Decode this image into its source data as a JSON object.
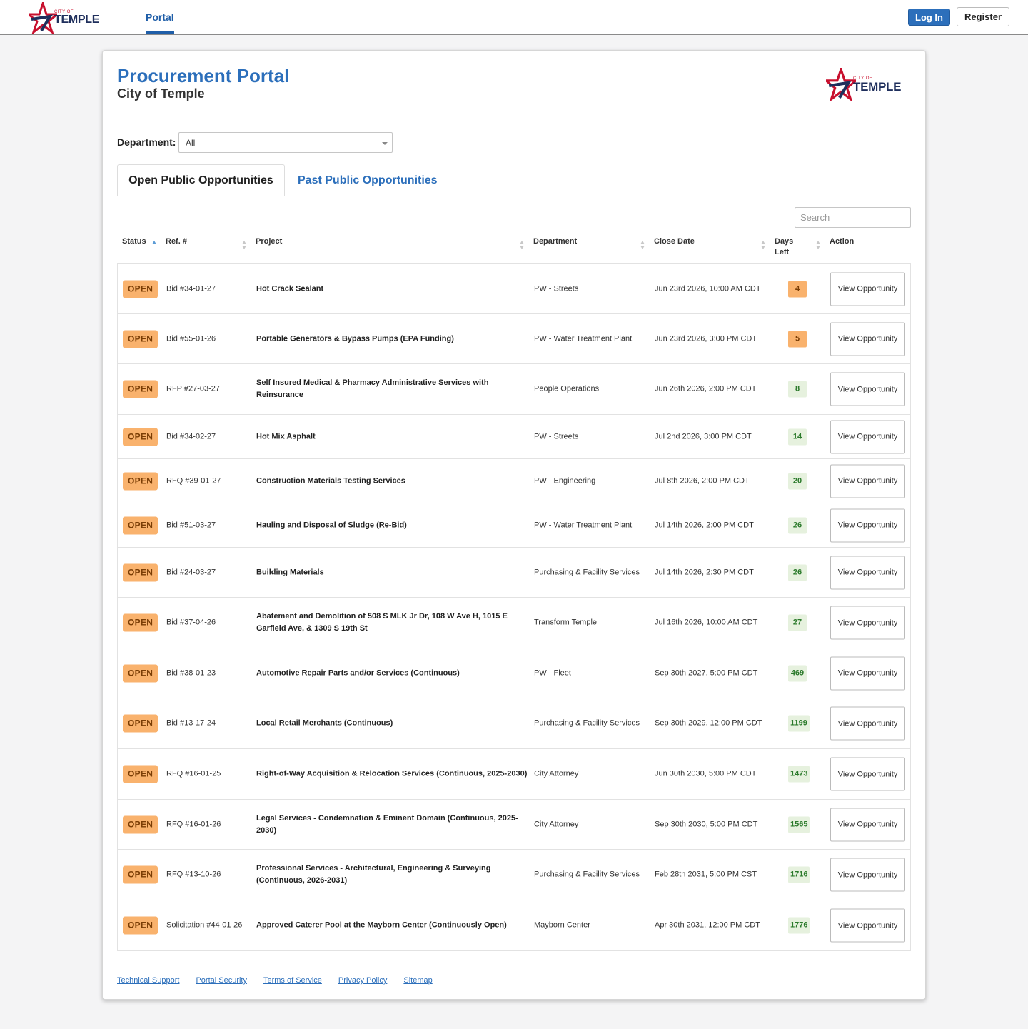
{
  "brand": {
    "city_of": "CITY OF",
    "temple": "TEMPLE"
  },
  "nav": {
    "portal_tab": "Portal",
    "login": "Log In",
    "register": "Register"
  },
  "header": {
    "title": "Procurement Portal",
    "subtitle": "City of Temple"
  },
  "filter": {
    "label": "Department:",
    "selected": "All"
  },
  "tabs": {
    "open": "Open Public Opportunities",
    "past": "Past Public Opportunities"
  },
  "search": {
    "placeholder": "Search"
  },
  "table": {
    "columns": [
      "Status",
      "Ref. #",
      "Project",
      "Department",
      "Close Date",
      "Days Left",
      "Action"
    ],
    "rows": [
      {
        "status": "OPEN",
        "ref": "Bid #34-01-27",
        "project": "Hot Crack Sealant",
        "department": "PW - Streets",
        "close": "Jun 23rd 2026, 10:00 AM CDT",
        "days": "4",
        "action": "View Opportunity"
      },
      {
        "status": "OPEN",
        "ref": "Bid #55-01-26",
        "project": "Portable Generators & Bypass Pumps (EPA Funding)",
        "department": "PW - Water Treatment Plant",
        "close": "Jun 23rd 2026, 3:00 PM CDT",
        "days": "5",
        "action": "View Opportunity"
      },
      {
        "status": "OPEN",
        "ref": "RFP #27-03-27",
        "project": "Self Insured Medical & Pharmacy Administrative Services with Reinsurance",
        "department": "People Operations",
        "close": "Jun 26th 2026, 2:00 PM CDT",
        "days": "8",
        "action": "View Opportunity"
      },
      {
        "status": "OPEN",
        "ref": "Bid #34-02-27",
        "project": "Hot Mix Asphalt",
        "department": "PW - Streets",
        "close": "Jul 2nd 2026, 3:00 PM CDT",
        "days": "14",
        "action": "View Opportunity"
      },
      {
        "status": "OPEN",
        "ref": "RFQ #39-01-27",
        "project": "Construction Materials Testing Services",
        "department": "PW - Engineering",
        "close": "Jul 8th 2026, 2:00 PM CDT",
        "days": "20",
        "action": "View Opportunity"
      },
      {
        "status": "OPEN",
        "ref": "Bid #51-03-27",
        "project": "Hauling and Disposal of Sludge (Re-Bid)",
        "department": "PW - Water Treatment Plant",
        "close": "Jul 14th 2026, 2:00 PM CDT",
        "days": "26",
        "action": "View Opportunity"
      },
      {
        "status": "OPEN",
        "ref": "Bid #24-03-27",
        "project": "Building Materials",
        "department": "Purchasing & Facility Services",
        "close": "Jul 14th 2026, 2:30 PM CDT",
        "days": "26",
        "action": "View Opportunity"
      },
      {
        "status": "OPEN",
        "ref": "Bid #37-04-26",
        "project": "Abatement and Demolition of 508 S MLK Jr Dr, 108 W Ave H, 1015 E Garfield Ave, & 1309 S 19th St",
        "department": "Transform Temple",
        "close": "Jul 16th 2026, 10:00 AM CDT",
        "days": "27",
        "action": "View Opportunity"
      },
      {
        "status": "OPEN",
        "ref": "Bid #38-01-23",
        "project": "Automotive Repair Parts and/or Services (Continuous)",
        "department": "PW - Fleet",
        "close": "Sep 30th 2027, 5:00 PM CDT",
        "days": "469",
        "action": "View Opportunity"
      },
      {
        "status": "OPEN",
        "ref": "Bid #13-17-24",
        "project": "Local Retail Merchants (Continuous)",
        "department": "Purchasing & Facility Services",
        "close": "Sep 30th 2029, 12:00 PM CDT",
        "days": "1199",
        "action": "View Opportunity"
      },
      {
        "status": "OPEN",
        "ref": "RFQ #16-01-25",
        "project": "Right-of-Way Acquisition & Relocation Services (Continuous, 2025-2030)",
        "department": "City Attorney",
        "close": "Jun 30th 2030, 5:00 PM CDT",
        "days": "1473",
        "action": "View Opportunity"
      },
      {
        "status": "OPEN",
        "ref": "RFQ #16-01-26",
        "project": "Legal Services - Condemnation & Eminent Domain (Continuous, 2025-2030)",
        "department": "City Attorney",
        "close": "Sep 30th 2030, 5:00 PM CDT",
        "days": "1565",
        "action": "View Opportunity"
      },
      {
        "status": "OPEN",
        "ref": "RFQ #13-10-26",
        "project": "Professional Services - Architectural, Engineering & Surveying (Continuous, 2026-2031)",
        "department": "Purchasing & Facility Services",
        "close": "Feb 28th 2031, 5:00 PM CST",
        "days": "1716",
        "action": "View Opportunity"
      },
      {
        "status": "OPEN",
        "ref": "Solicitation #44-01-26",
        "project": "Approved Caterer Pool at the Mayborn Center (Continuously Open)",
        "department": "Mayborn Center",
        "close": "Apr 30th 2031, 12:00 PM CDT",
        "days": "1776",
        "action": "View Opportunity"
      }
    ]
  },
  "footer": {
    "links": [
      "Technical Support",
      "Portal Security",
      "Terms of Service",
      "Privacy Policy",
      "Sitemap"
    ]
  },
  "colors": {
    "accent": "#2c6fbb",
    "open_badge": "#f9b26d",
    "days_ok_bg": "#e6f1de",
    "days_ok_text": "#2b7a2b"
  }
}
